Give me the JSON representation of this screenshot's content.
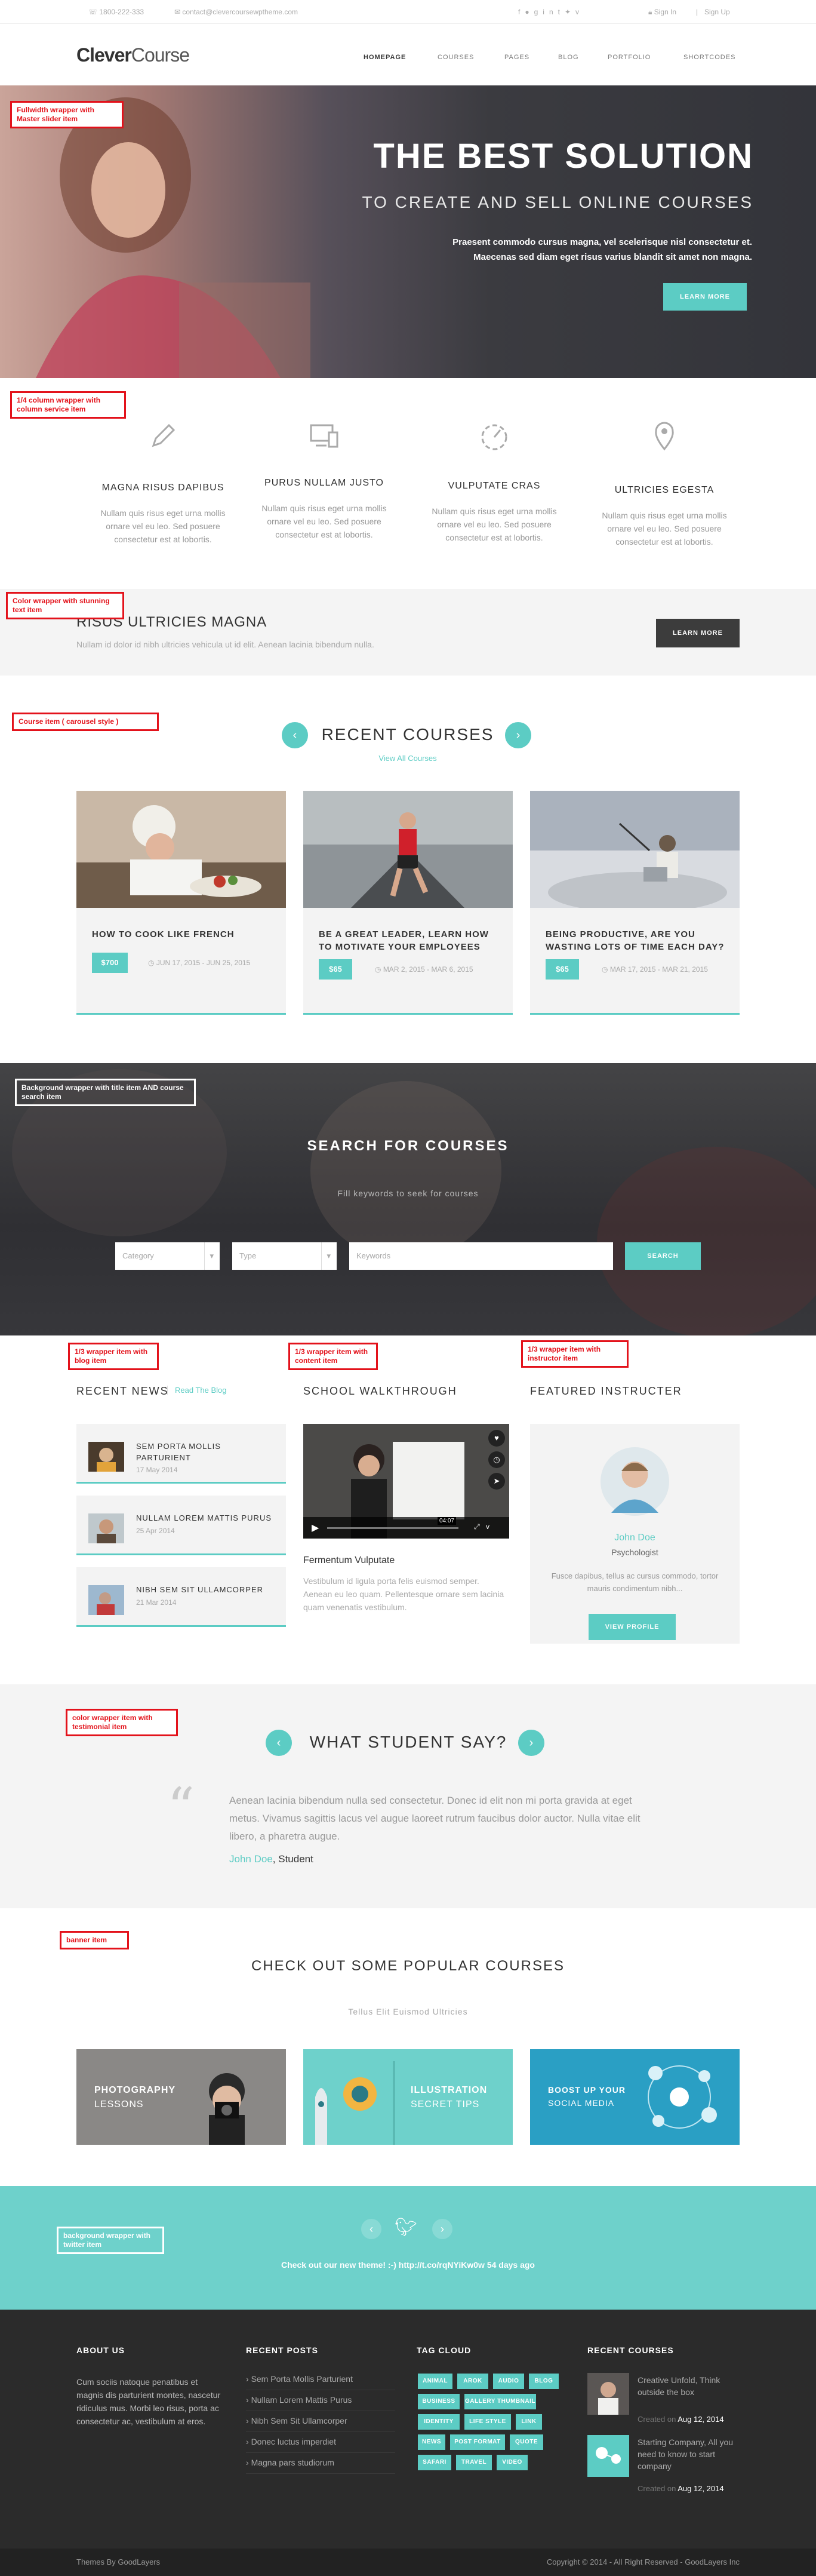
{
  "topbar": {
    "phone": "1800-222-333",
    "email": "contact@clevercoursewptheme.com",
    "sign_in": "Sign In",
    "sign_up": "Sign Up",
    "social_icons": [
      "facebook-icon",
      "flickr-icon",
      "google-plus-icon",
      "linkedin-icon",
      "tumblr-icon",
      "twitter-icon",
      "vimeo-icon"
    ]
  },
  "header": {
    "logo_a": "Clever",
    "logo_b": "Course",
    "nav": [
      "HOMEPAGE",
      "COURSES",
      "PAGES",
      "BLOG",
      "PORTFOLIO",
      "SHORTCODES"
    ]
  },
  "notes": {
    "hero": "Fullwidth wrapper with Master slider item",
    "services": "1/4 column wrapper with column service item",
    "stunning": "Color wrapper with stunning text item",
    "courses": "Course item ( carousel style )",
    "search": "Background wrapper with title item AND course search item",
    "blog": "1/3 wrapper item with blog item",
    "content": "1/3 wrapper item with content item",
    "instructor": "1/3 wrapper item with instructor item",
    "testimonial": "color wrapper item with testimonial item",
    "banner": "banner item",
    "twitter": "background wrapper with twitter item"
  },
  "hero": {
    "title": "THE BEST SOLUTION",
    "subtitle": "TO CREATE AND SELL ONLINE COURSES",
    "text1": "Praesent commodo cursus magna, vel scelerisque nisl consectetur et.",
    "text2": "Maecenas sed diam eget risus varius blandit sit amet non magna.",
    "button": "LEARN MORE"
  },
  "services": [
    {
      "icon": "pencil-icon",
      "title": "MAGNA RISUS DAPIBUS",
      "text": "Nullam quis risus eget urna mollis ornare vel eu leo. Sed posuere consectetur est at lobortis."
    },
    {
      "icon": "devices-icon",
      "title": "PURUS NULLAM JUSTO",
      "text": "Nullam quis risus eget urna mollis ornare vel eu leo. Sed posuere consectetur est at lobortis."
    },
    {
      "icon": "dashboard-icon",
      "title": "VULPUTATE CRAS",
      "text": "Nullam quis risus eget urna mollis ornare vel eu leo. Sed posuere consectetur est at lobortis."
    },
    {
      "icon": "map-pin-icon",
      "title": "ULTRICIES EGESTA",
      "text": "Nullam quis risus eget urna mollis ornare vel eu leo. Sed posuere consectetur est at lobortis."
    }
  ],
  "stunning": {
    "title": "RISUS ULTRICIES MAGNA",
    "text": "Nullam id dolor id nibh ultricies vehicula ut id elit. Aenean lacinia bibendum nulla.",
    "button": "LEARN MORE"
  },
  "courses": {
    "title": "RECENT COURSES",
    "link": "View All Courses",
    "items": [
      {
        "title": "HOW TO COOK LIKE FRENCH",
        "price": "$700",
        "date": "JUN 17, 2015 - JUN 25, 2015"
      },
      {
        "title": "BE A GREAT LEADER, LEARN HOW TO MOTIVATE YOUR EMPLOYEES",
        "price": "$65",
        "date": "MAR 2, 2015 - MAR 6, 2015"
      },
      {
        "title": "BEING PRODUCTIVE, ARE YOU WASTING LOTS OF TIME EACH DAY?",
        "price": "$65",
        "date": "MAR 17, 2015 - MAR 21, 2015"
      }
    ]
  },
  "search": {
    "title": "SEARCH FOR COURSES",
    "subtitle": "Fill keywords to seek for courses",
    "category": "Category",
    "type": "Type",
    "keywords": "Keywords",
    "button": "SEARCH"
  },
  "news": {
    "title": "RECENT NEWS",
    "link": "Read The Blog",
    "items": [
      {
        "title": "SEM PORTA MOLLIS PARTURIENT",
        "date": "17 May 2014"
      },
      {
        "title": "NULLAM LOREM MATTIS PURUS",
        "date": "25 Apr 2014"
      },
      {
        "title": "NIBH SEM SIT ULLAMCORPER",
        "date": "21 Mar 2014"
      }
    ]
  },
  "walkthrough": {
    "title": "SCHOOL WALKTHROUGH",
    "video_time": "04:07",
    "caption": "Fermentum Vulputate",
    "text": "Vestibulum id ligula porta felis euismod semper. Aenean eu leo quam. Pellentesque ornare sem lacinia quam venenatis vestibulum."
  },
  "instructor": {
    "title": "FEATURED INSTRUCTER",
    "name": "John Doe",
    "role": "Psychologist",
    "text": "Fusce dapibus, tellus ac cursus commodo, tortor mauris condimentum nibh...",
    "button": "VIEW PROFILE"
  },
  "testimonial": {
    "title": "WHAT STUDENT SAY?",
    "quote": "Aenean lacinia bibendum nulla sed consectetur. Donec id elit non mi porta gravida at eget metus. Vivamus sagittis lacus vel augue laoreet rutrum faucibus dolor auctor. Nulla vitae elit libero, a pharetra augue.",
    "author": "John Doe",
    "author_suffix": ", Student"
  },
  "popular": {
    "title": "CHECK OUT SOME POPULAR COURSES",
    "subtitle": "Tellus Elit Euismod Ultricies",
    "banners": [
      {
        "line1": "PHOTOGRAPHY",
        "line2": "LESSONS"
      },
      {
        "line1": "ILLUSTRATION",
        "line2": "SECRET TIPS"
      },
      {
        "line1": "BOOST UP YOUR",
        "line2": "SOCIAL MEDIA"
      }
    ]
  },
  "twitter": {
    "text": "Check out our new theme! :-) http://t.co/rqNYiKw0w 54 days ago"
  },
  "footer": {
    "about_title": "ABOUT US",
    "about_text": "Cum sociis natoque penatibus et magnis dis parturient montes, nascetur ridiculus mus. Morbi leo risus, porta ac consectetur ac, vestibulum at eros.",
    "posts_title": "RECENT POSTS",
    "posts": [
      "Sem Porta Mollis Parturient",
      "Nullam Lorem Mattis Purus",
      "Nibh Sem Sit Ullamcorper",
      "Donec luctus imperdiet",
      "Magna pars studiorum"
    ],
    "tags_title": "TAG CLOUD",
    "tags": [
      "ANIMAL",
      "AROK",
      "AUDIO",
      "BLOG",
      "BUSINESS",
      "GALLERY THUMBNAIL",
      "IDENTITY",
      "LIFE STYLE",
      "LINK",
      "NEWS",
      "POST FORMAT",
      "QUOTE",
      "SAFARI",
      "TRAVEL",
      "VIDEO"
    ],
    "courses_title": "RECENT COURSES",
    "courses": [
      {
        "title": "Creative Unfold, Think outside the box",
        "date_label": "Created on",
        "date": "Aug 12, 2014"
      },
      {
        "title": "Starting Company, All you need to know to start company",
        "date_label": "Created on",
        "date": "Aug 12, 2014"
      }
    ]
  },
  "copyright": {
    "left": "Themes By GoodLayers",
    "right": "Copyright © 2014 - All Right Reserved - GoodLayers Inc"
  },
  "colors": {
    "accent": "#5cccc4",
    "dark": "#2b2b2b",
    "note": "#e3121b"
  }
}
